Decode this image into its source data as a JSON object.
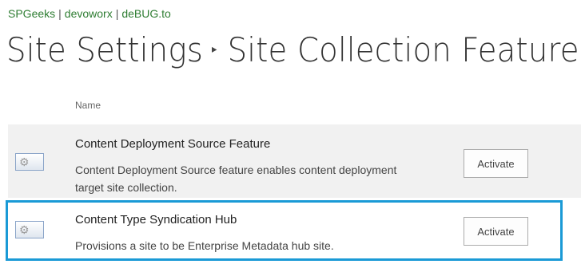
{
  "breadcrumb": {
    "items": [
      "SPGeeks",
      "devoworx",
      "deBUG.to"
    ],
    "separator": "|"
  },
  "page": {
    "title_root": "Site Settings",
    "title_current": "Site Collection Features",
    "arrow_glyph": "▸"
  },
  "table": {
    "column_name": "Name"
  },
  "features": [
    {
      "title": "Content Deployment Source Feature",
      "description": "Content Deployment Source feature enables content deployment target site collection.",
      "description_line1": "Content Deployment Source feature enables content deployment",
      "description_line2": "target site collection.",
      "button_label": "Activate",
      "icon": "feature-gear-icon",
      "highlighted": false
    },
    {
      "title": "Content Type Syndication Hub",
      "description": "Provisions a site to be Enterprise Metadata hub site.",
      "button_label": "Activate",
      "icon": "feature-gear-icon",
      "highlighted": true
    }
  ],
  "colors": {
    "breadcrumb_link": "#2e7d32",
    "highlight_border": "#1a9ad6",
    "row_shaded_bg": "#f1f1f1"
  }
}
